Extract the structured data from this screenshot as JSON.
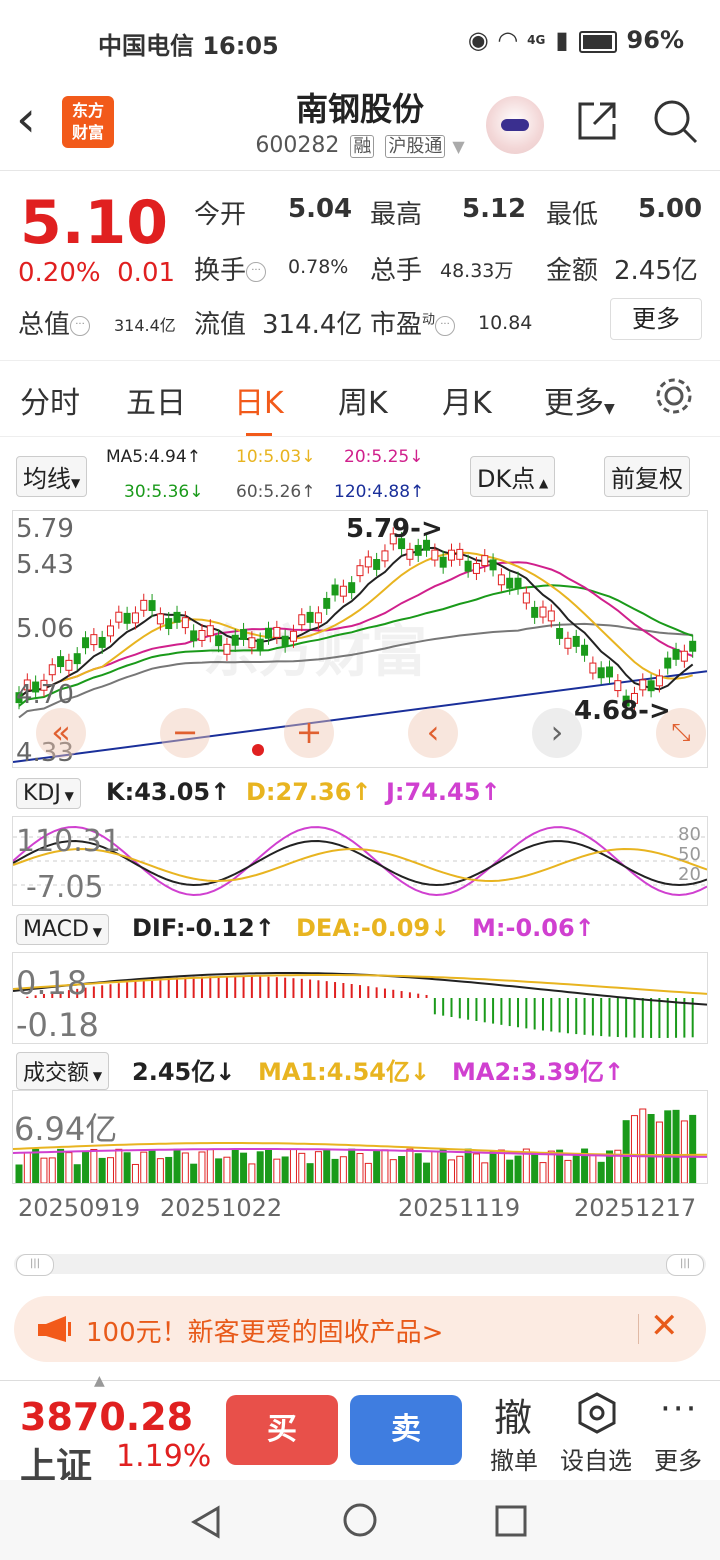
{
  "status_bar": {
    "carrier": "中国电信",
    "time": "16:05",
    "network": "4G",
    "battery": "96%"
  },
  "header": {
    "logo_line1": "东方",
    "logo_line2": "财富",
    "title": "南钢股份",
    "code": "600282",
    "tag_margin": "融",
    "tag_connect": "沪股通"
  },
  "quote": {
    "price": "5.10",
    "change_pct": "0.20%",
    "change": "0.01",
    "open_label": "今开",
    "open": "5.04",
    "high_label": "最高",
    "high": "5.12",
    "low_label": "最低",
    "low": "5.00",
    "turnover_label": "换手",
    "turnover": "0.78%",
    "volume_label": "总手",
    "volume": "48.33万",
    "amount_label": "金额",
    "amount": "2.45亿",
    "mktcap_label": "总值",
    "mktcap": "314.4亿",
    "float_label": "流值",
    "float": "314.4亿",
    "pe_label": "市盈",
    "pe_sup": "动",
    "pe": "10.84",
    "more": "更多"
  },
  "tabs": [
    "分时",
    "五日",
    "日K",
    "周K",
    "月K",
    "更多"
  ],
  "kline": {
    "ma_select": "均线",
    "ma5": "MA5:4.94↑",
    "ma10": "10:5.03↓",
    "ma20": "20:5.25↓",
    "ma30": "30:5.36↓",
    "ma60": "60:5.26↑",
    "ma120": "120:4.88↑",
    "dk_btn": "DK点",
    "adj_btn": "前复权",
    "y_labels": [
      "5.79",
      "5.43",
      "5.06",
      "4.70",
      "4.33"
    ],
    "high_marker": "5.79->",
    "low_marker": "4.68->",
    "watermark": "东方财富",
    "colors": {
      "ma5": "#222222",
      "ma10": "#e8b420",
      "ma20": "#d0208c",
      "ma30": "#1a9a1a",
      "ma60": "#777777",
      "ma120": "#1a2f9a",
      "up": "#e02020",
      "down": "#1a9a1a"
    }
  },
  "kdj": {
    "select": "KDJ",
    "k": "K:43.05↑",
    "d": "D:27.36↑",
    "j": "J:74.45↑",
    "y_top": "110.31",
    "y_bottom": "-7.05",
    "r80": "80",
    "r50": "50",
    "r20": "20"
  },
  "macd": {
    "select": "MACD",
    "dif": "DIF:-0.12↑",
    "dea": "DEA:-0.09↓",
    "m": "M:-0.06↑",
    "y_top": "0.18",
    "y_bottom": "-0.18"
  },
  "vol": {
    "select": "成交额",
    "val": "2.45亿↓",
    "ma1": "MA1:4.54亿↓",
    "ma2": "MA2:3.39亿↑",
    "y_top": "6.94亿"
  },
  "dates": [
    "20250919",
    "20251022",
    "20251119",
    "20251217"
  ],
  "banner": {
    "text": "100元！新客更爱的固收产品>"
  },
  "bottom": {
    "index_value": "3870.28",
    "index_name": "上证",
    "index_pct": "1.19%",
    "buy": "买",
    "sell": "卖",
    "cancel_icon_char": "撤",
    "cancel": "撤单",
    "watch": "设自选",
    "more": "更多"
  }
}
